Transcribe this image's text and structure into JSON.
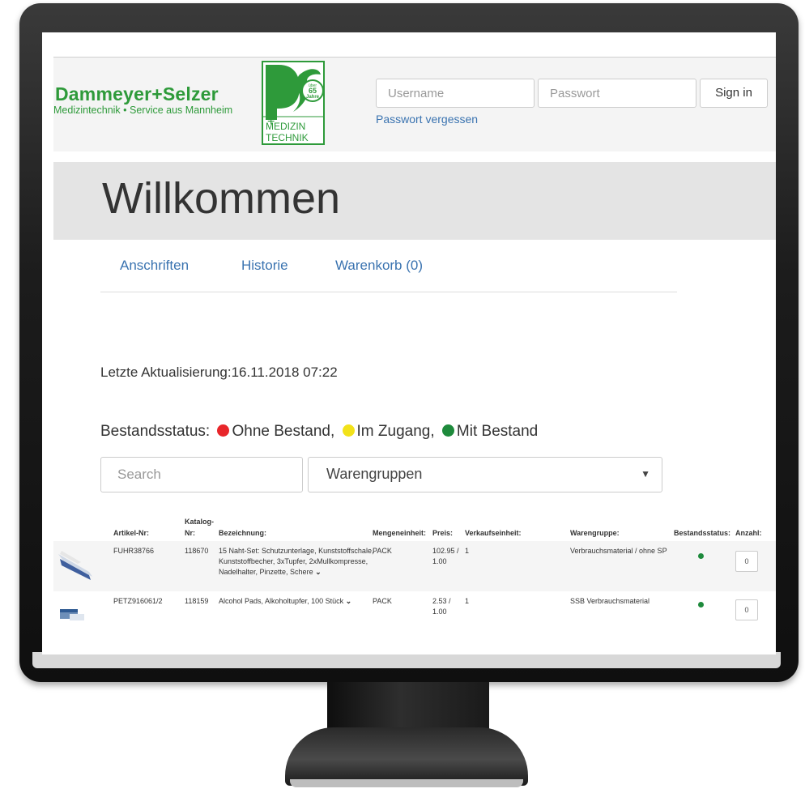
{
  "header": {
    "brand_name": "Dammeyer+Selzer",
    "brand_tagline": "Medizintechnik • Service aus Mannheim",
    "logo": {
      "plus": "+",
      "badge_top": "über",
      "badge_years": "65",
      "badge_word": "Jahre",
      "line1": "MEDIZIN",
      "line2": "TECHNIK"
    },
    "username_placeholder": "Username",
    "password_placeholder": "Passwort",
    "signin_label": "Sign in",
    "forgot_label": "Passwort vergessen"
  },
  "jumbotron": {
    "title": "Willkommen"
  },
  "tabs": [
    {
      "label": "Anschriften"
    },
    {
      "label": "Historie"
    },
    {
      "label": "Warenkorb (0)"
    }
  ],
  "last_update": "Letzte Aktualisierung:16.11.2018 07:22",
  "legend": {
    "label": "Bestandsstatus:",
    "items": [
      {
        "label": "Ohne Bestand,",
        "color": "#e8262a"
      },
      {
        "label": "Im Zugang,",
        "color": "#f2e21a"
      },
      {
        "label": "Mit Bestand",
        "color": "#1e8a3c"
      }
    ]
  },
  "filters": {
    "search_placeholder": "Search",
    "group_selected": "Warengruppen",
    "caret": "▼"
  },
  "table": {
    "headers": {
      "artikel": "Artikel-Nr:",
      "katalog_1": "Katalog-",
      "katalog_2": "Nr:",
      "bezeichnung": "Bezeichnung:",
      "menge": "Mengeneinheit:",
      "preis": "Preis:",
      "verkauf": "Verkaufseinheit:",
      "gruppe": "Warengruppe:",
      "status": "Bestandsstatus:",
      "anzahl": "Anzahl:"
    },
    "rows": [
      {
        "artikel": "FUHR38766",
        "katalog": "118670",
        "bez_1": "15 Naht-Set: Schutzunterlage, Kunststoffschale,",
        "bez_2": "Kunststoffbecher, 3xTupfer, 2xMullkompresse,",
        "bez_3": "Nadelhalter, Pinzette, Schere",
        "chevron": "⌄",
        "menge": "PACK",
        "preis_1": "102.95 /",
        "preis_2": "1.00",
        "verkauf": "1",
        "gruppe": "Verbrauchsmaterial / ohne SP",
        "status_color": "#1e8a3c",
        "anzahl": "0"
      },
      {
        "artikel": "PETZ916061/2",
        "katalog": "118159",
        "bez_1": "Alcohol Pads, Alkoholtupfer, 100 Stück",
        "chevron": "⌄",
        "menge": "PACK",
        "preis_1": "2.53 /",
        "preis_2": "1.00",
        "verkauf": "1",
        "gruppe": "SSB Verbrauchsmaterial",
        "status_color": "#1e8a3c",
        "anzahl": "0"
      }
    ]
  },
  "colors": {
    "brand_green": "#2e9a3a",
    "link_blue": "#3a73b0",
    "bezel": "#1c1c1c"
  }
}
